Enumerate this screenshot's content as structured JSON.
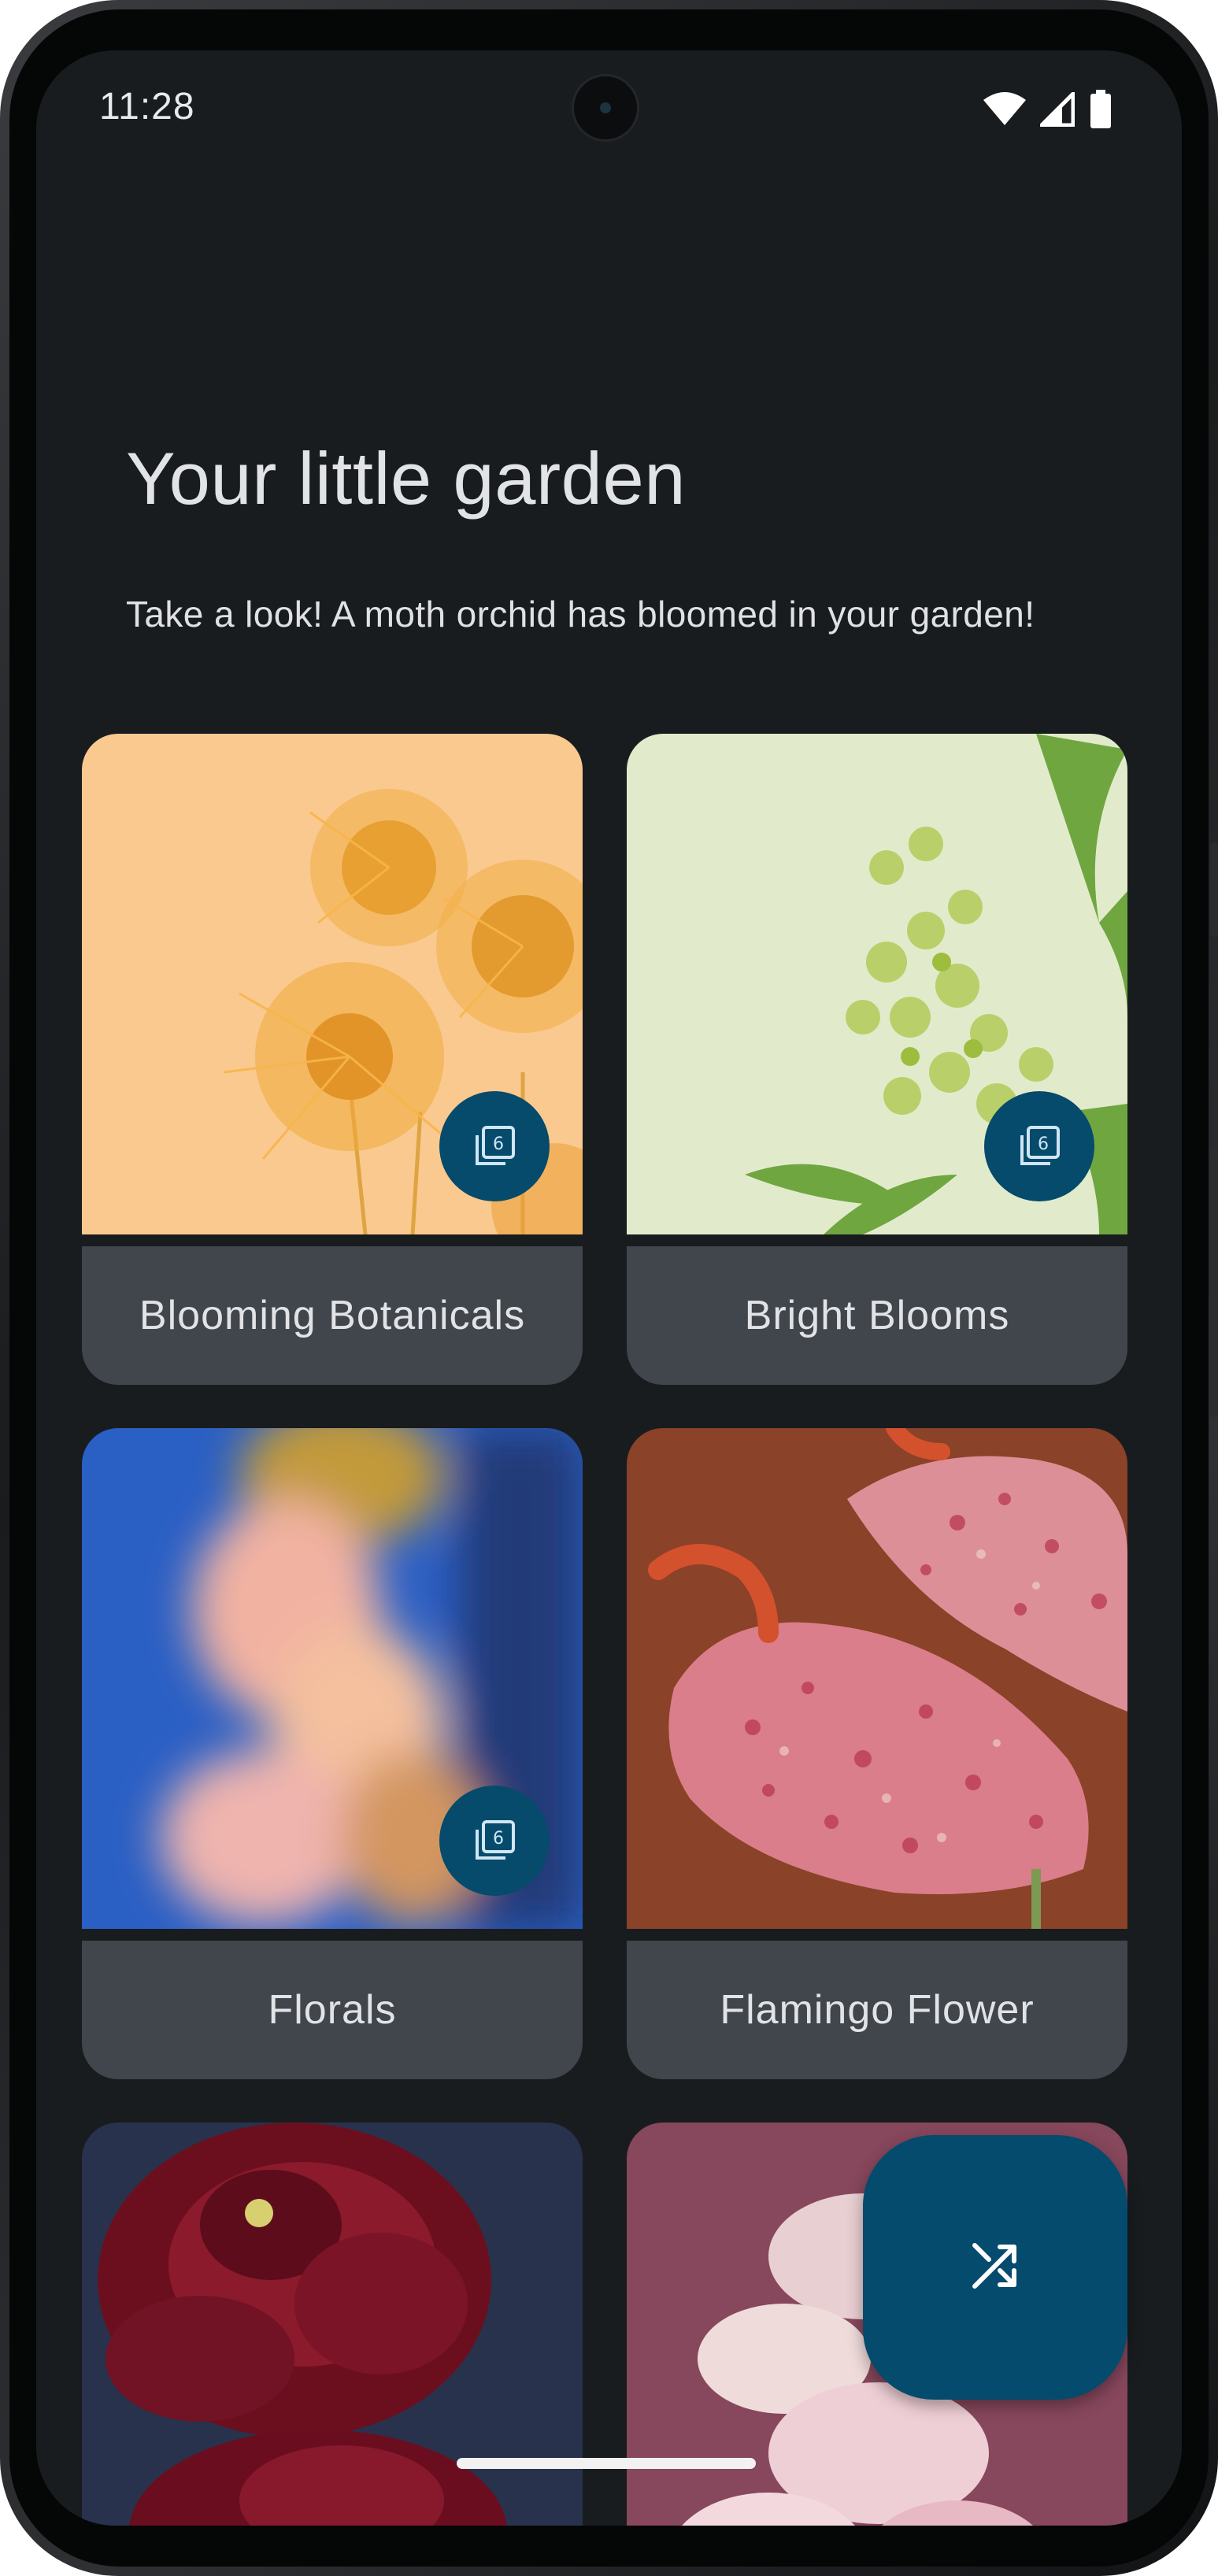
{
  "status_bar": {
    "time": "11:28",
    "icons": [
      "wifi-icon",
      "cellular-signal-icon",
      "battery-icon"
    ]
  },
  "page": {
    "title": "Your little garden",
    "subtitle": "Take a look! A moth orchid has bloomed in your garden!"
  },
  "cards": [
    {
      "label": "Blooming Botanicals",
      "collection_icon": "collection-icon",
      "image": "orange pincushion protea flowers"
    },
    {
      "label": "Bright Blooms",
      "collection_icon": "collection-icon",
      "image": "green bell flowers on pale green"
    },
    {
      "label": "Florals",
      "collection_icon": "collection-icon",
      "image": "blurred pink flowers on blue"
    },
    {
      "label": "Flamingo Flower",
      "image": "speckled pink anthurium on brown"
    },
    {
      "label": "",
      "image": "dark red ranunculus"
    },
    {
      "label": "",
      "image": "pale pink flowers on mauve"
    }
  ],
  "fab": {
    "icon": "shuffle-icon"
  },
  "colors": {
    "background": "#191c1f",
    "card_label_bg": "#40464c",
    "accent": "#044b6d",
    "text": "#e2e3e6"
  }
}
